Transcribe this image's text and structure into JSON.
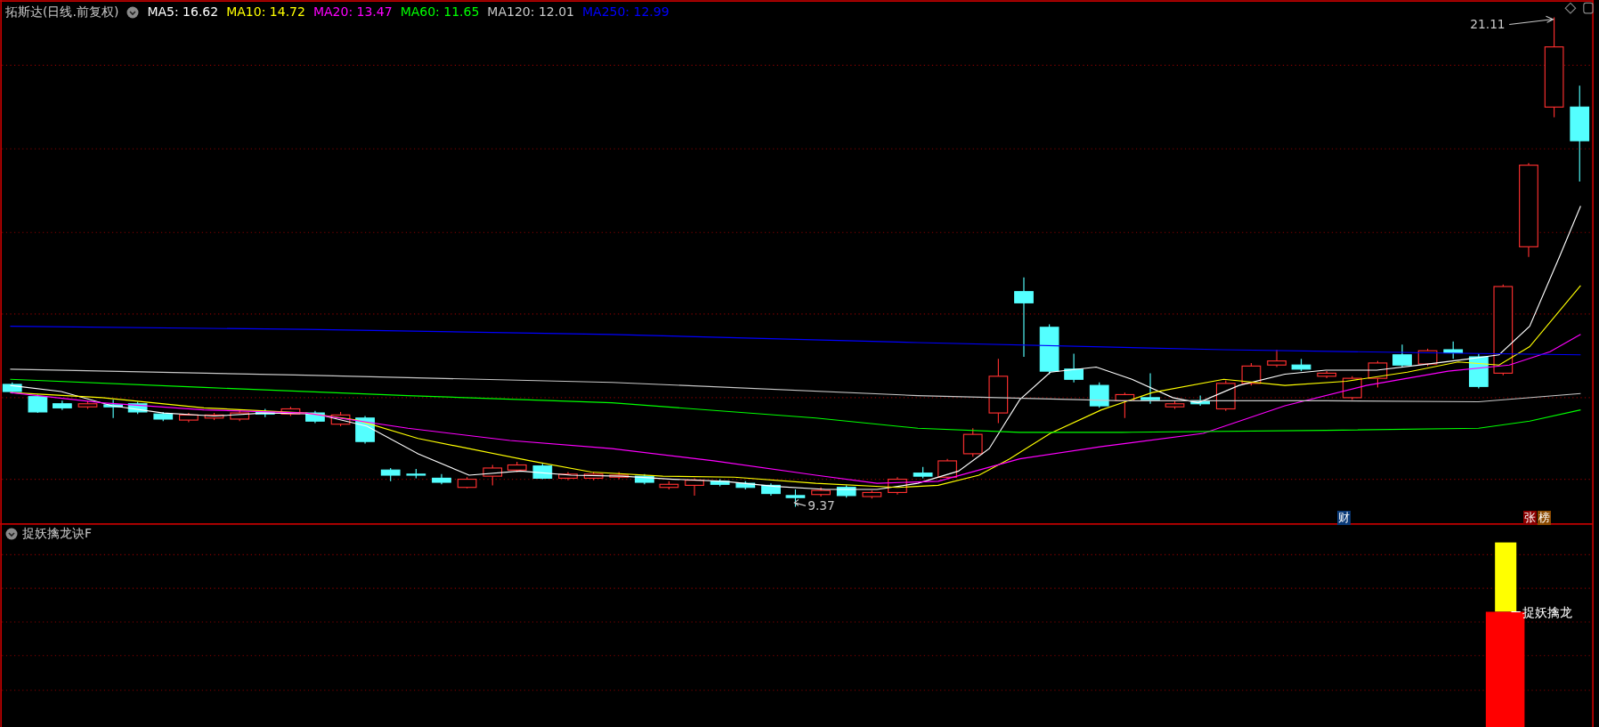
{
  "header": {
    "title": "拓斯达(日线.前复权)",
    "ma_items": [
      {
        "label": "MA5: 16.62",
        "color": "#ffffff"
      },
      {
        "label": "MA10: 14.72",
        "color": "#ffff00"
      },
      {
        "label": "MA20: 13.47",
        "color": "#ff00ff"
      },
      {
        "label": "MA60: 11.65",
        "color": "#00ff00"
      },
      {
        "label": "MA120: 12.01",
        "color": "#c8c8c8"
      },
      {
        "label": "MA250: 12.99",
        "color": "#0000ff"
      }
    ]
  },
  "main_chart": {
    "high_label": "21.11",
    "low_label": "9.37",
    "markers": [
      {
        "label": "财",
        "color": "#0a3a78"
      },
      {
        "label": "张",
        "color": "#8b0000"
      },
      {
        "label": "榜",
        "color": "#8b4a00"
      }
    ]
  },
  "indicator": {
    "title": "捉妖擒龙诀F",
    "signal_label": "捉妖擒龙"
  }
}
